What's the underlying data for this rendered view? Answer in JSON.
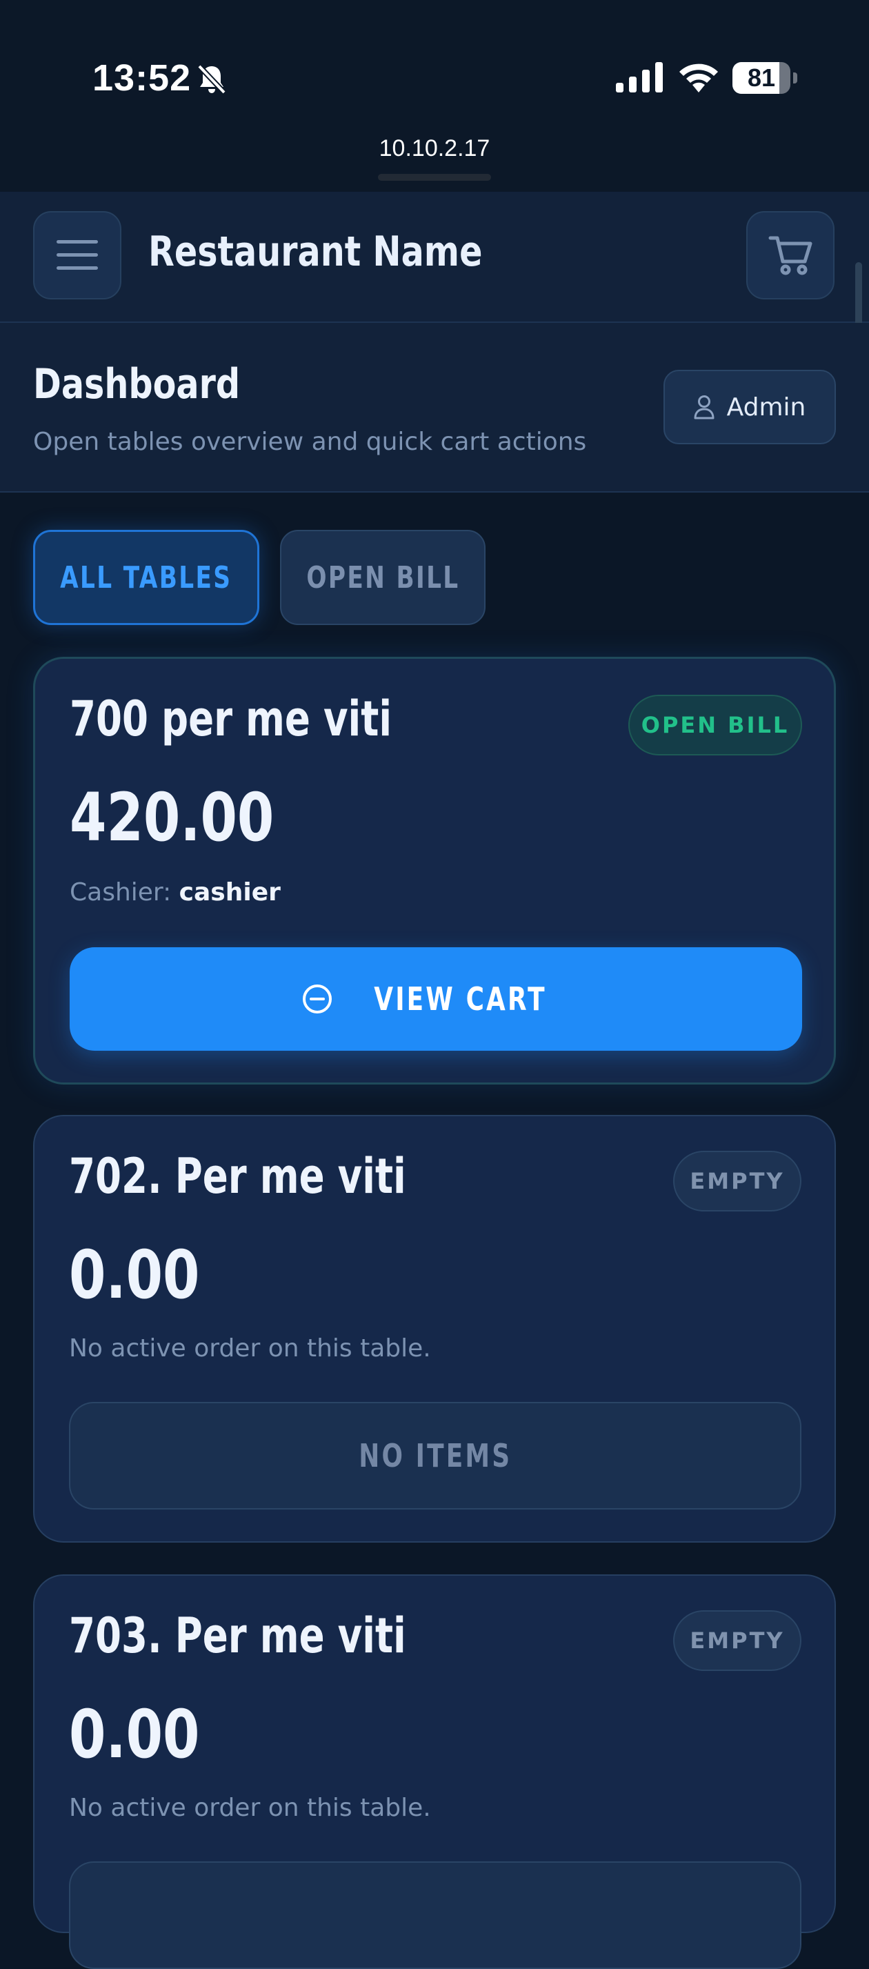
{
  "status_bar": {
    "time": "13:52",
    "battery": "81",
    "battery_level": 0.81,
    "url": "10.10.2.17",
    "icons": [
      "bell-slash-icon",
      "signal-icon",
      "wifi-icon",
      "battery-icon"
    ]
  },
  "app": {
    "title": "Restaurant Name",
    "menu_icon": "hamburger-menu-icon",
    "cart_icon": "shopping-cart-icon"
  },
  "header": {
    "title": "Dashboard",
    "subtitle": "Open tables overview and quick cart actions",
    "user_label": "Admin",
    "user_icon": "user-icon"
  },
  "filters": [
    {
      "label": "ALL TABLES",
      "active": true
    },
    {
      "label": "OPEN BILL",
      "active": false
    }
  ],
  "tables": [
    {
      "name": "700 per me viti",
      "status": "OPEN BILL",
      "amount": "420.00",
      "cashier_label": "Cashier:",
      "cashier": "cashier",
      "action": "VIEW CART"
    },
    {
      "name": "702. Per me viti",
      "status": "EMPTY",
      "amount": "0.00",
      "note": "No active order on this table.",
      "action": "NO ITEMS"
    },
    {
      "name": "703. Per me viti",
      "status": "EMPTY",
      "amount": "0.00",
      "note": "No active order on this table."
    }
  ],
  "colors": {
    "background": "#0b1727",
    "card": "#15284a",
    "accent": "#1f8bf8",
    "open_badge": "#22c08a",
    "muted_text": "#7d93b2"
  }
}
